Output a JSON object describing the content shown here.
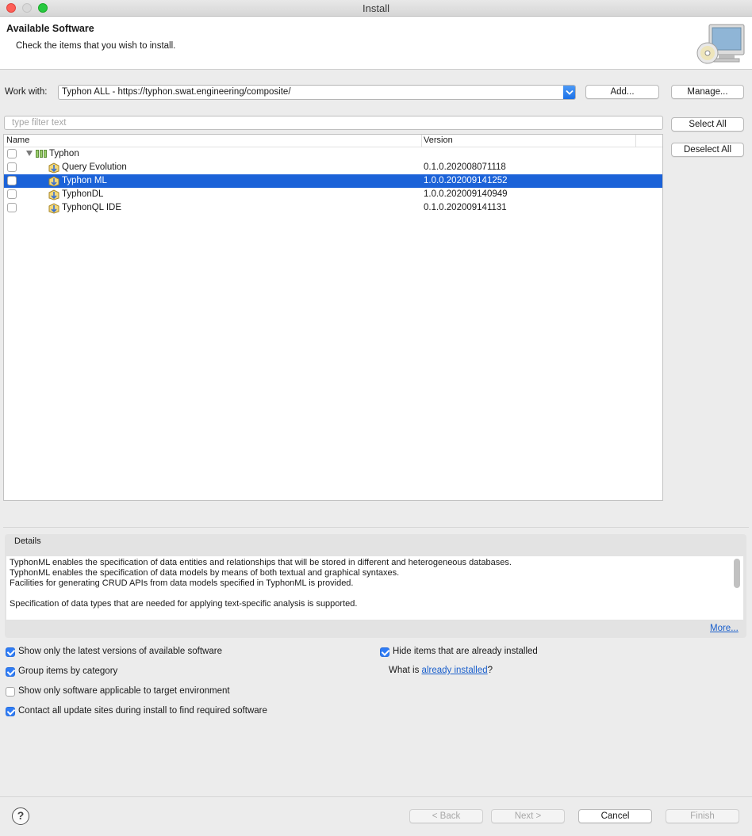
{
  "window": {
    "title": "Install"
  },
  "banner": {
    "title": "Available Software",
    "description": "Check the items that you wish to install."
  },
  "work_with": {
    "label": "Work with:",
    "value": "Typhon ALL - https://typhon.swat.engineering/composite/",
    "add_label": "Add...",
    "manage_label": "Manage..."
  },
  "filter": {
    "placeholder": "type filter text"
  },
  "buttons": {
    "select_all": "Select All",
    "deselect_all": "Deselect All"
  },
  "tree": {
    "columns": [
      "Name",
      "Version"
    ],
    "category": {
      "name": "Typhon",
      "checked": false,
      "expanded": true
    },
    "items": [
      {
        "name": "Query Evolution",
        "version": "0.1.0.202008071118",
        "checked": false,
        "selected": false
      },
      {
        "name": "Typhon ML",
        "version": "1.0.0.202009141252",
        "checked": false,
        "selected": true
      },
      {
        "name": "TyphonDL",
        "version": "1.0.0.202009140949",
        "checked": false,
        "selected": false
      },
      {
        "name": "TyphonQL IDE",
        "version": "0.1.0.202009141131",
        "checked": false,
        "selected": false
      }
    ]
  },
  "details": {
    "label": "Details",
    "lines": [
      "TyphonML enables the specification of data entities and relationships that will be stored in different and heterogeneous databases.",
      "TyphonML enables the specification of data models by means of both textual and graphical syntaxes.",
      "Facilities for generating CRUD APIs from data models specified in TyphonML is provided.",
      "",
      "Specification of data types that are needed for applying text-specific analysis is supported."
    ],
    "more_label": "More..."
  },
  "options": {
    "latest_only": {
      "label": "Show only the latest versions of available software",
      "checked": true
    },
    "group_by_category": {
      "label": "Group items by category",
      "checked": true
    },
    "target_env_only": {
      "label": "Show only software applicable to target environment",
      "checked": false
    },
    "contact_all_sites": {
      "label": "Contact all update sites during install to find required software",
      "checked": true
    },
    "hide_installed": {
      "label": "Hide items that are already installed",
      "checked": true
    },
    "what_is_prefix": "What is ",
    "already_installed_link": "already installed",
    "what_is_suffix": "?"
  },
  "footer": {
    "help_label": "?",
    "back_label": "< Back",
    "next_label": "Next >",
    "cancel_label": "Cancel",
    "finish_label": "Finish"
  },
  "colors": {
    "selection": "#1b62d8",
    "checkbox_checked": "#2f7cf6",
    "link": "#1a5fcc"
  }
}
